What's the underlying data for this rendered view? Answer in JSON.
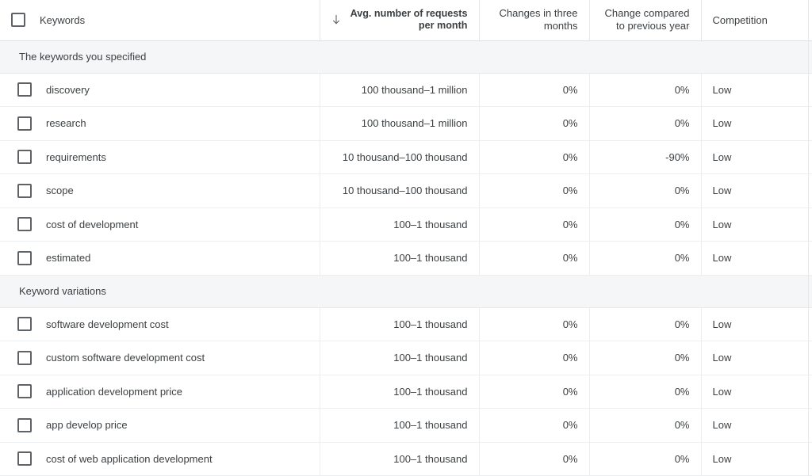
{
  "table": {
    "columns": [
      {
        "key": "keyword",
        "label": "Keywords",
        "align": "left",
        "sorted": false,
        "sort_icon": "arrow-down-icon"
      },
      {
        "key": "avg",
        "label": "Avg. number of requests per month",
        "align": "right",
        "sorted": true,
        "sort_icon": "arrow-down-icon"
      },
      {
        "key": "three",
        "label": "Changes in three months",
        "align": "right",
        "sorted": false,
        "sort_icon": ""
      },
      {
        "key": "year",
        "label": "Change compared to previous year",
        "align": "right",
        "sorted": false,
        "sort_icon": ""
      },
      {
        "key": "competition",
        "label": "Competition",
        "align": "left",
        "sorted": false,
        "sort_icon": ""
      }
    ],
    "select_all_checkbox": {
      "icon": "checkbox-unchecked-icon",
      "checked": false
    },
    "sections": [
      {
        "title": "The keywords you specified",
        "rows": [
          {
            "keyword": "discovery",
            "avg": "100 thousand–1 million",
            "three": "0%",
            "year": "0%",
            "competition": "Low",
            "checked": false
          },
          {
            "keyword": "research",
            "avg": "100 thousand–1 million",
            "three": "0%",
            "year": "0%",
            "competition": "Low",
            "checked": false
          },
          {
            "keyword": "requirements",
            "avg": "10 thousand–100 thousand",
            "three": "0%",
            "year": "-90%",
            "competition": "Low",
            "checked": false
          },
          {
            "keyword": "scope",
            "avg": "10 thousand–100 thousand",
            "three": "0%",
            "year": "0%",
            "competition": "Low",
            "checked": false
          },
          {
            "keyword": "cost of development",
            "avg": "100–1 thousand",
            "three": "0%",
            "year": "0%",
            "competition": "Low",
            "checked": false
          },
          {
            "keyword": "estimated",
            "avg": "100–1 thousand",
            "three": "0%",
            "year": "0%",
            "competition": "Low",
            "checked": false
          }
        ]
      },
      {
        "title": "Keyword variations",
        "rows": [
          {
            "keyword": "software development cost",
            "avg": "100–1 thousand",
            "three": "0%",
            "year": "0%",
            "competition": "Low",
            "checked": false
          },
          {
            "keyword": "custom software development cost",
            "avg": "100–1 thousand",
            "three": "0%",
            "year": "0%",
            "competition": "Low",
            "checked": false
          },
          {
            "keyword": "application development price",
            "avg": "100–1 thousand",
            "three": "0%",
            "year": "0%",
            "competition": "Low",
            "checked": false
          },
          {
            "keyword": "app develop price",
            "avg": "100–1 thousand",
            "three": "0%",
            "year": "0%",
            "competition": "Low",
            "checked": false
          },
          {
            "keyword": "cost of web application development",
            "avg": "100–1 thousand",
            "three": "0%",
            "year": "0%",
            "competition": "Low",
            "checked": false
          }
        ]
      }
    ]
  },
  "colors": {
    "text": "#3c4043",
    "group_background": "#f5f6f7",
    "border": "#e8e8e8",
    "checkbox_border": "#5f6368"
  }
}
